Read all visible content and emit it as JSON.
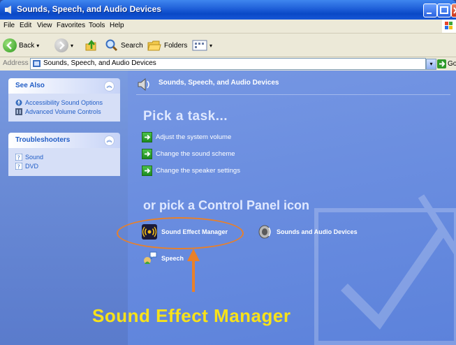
{
  "window": {
    "title": "Sounds, Speech, and Audio Devices",
    "controls": {
      "minimize": "minimize",
      "maximize": "maximize",
      "close": "close"
    }
  },
  "menubar": {
    "items": [
      "File",
      "Edit",
      "View",
      "Favorites",
      "Tools",
      "Help"
    ]
  },
  "toolbar": {
    "back_label": "Back",
    "search_label": "Search",
    "folders_label": "Folders"
  },
  "address": {
    "label": "Address",
    "value": "Sounds, Speech, and Audio Devices",
    "go_label": "Go"
  },
  "sidebar": {
    "see_also": {
      "title": "See Also",
      "items": [
        "Accessibility Sound Options",
        "Advanced Volume Controls"
      ]
    },
    "troubleshooters": {
      "title": "Troubleshooters",
      "items": [
        "Sound",
        "DVD"
      ]
    }
  },
  "main": {
    "category_title": "Sounds, Speech, and Audio Devices",
    "pick_task": "Pick a task...",
    "tasks": [
      "Adjust the system volume",
      "Change the sound scheme",
      "Change the speaker settings"
    ],
    "or_pick": "or pick a Control Panel icon",
    "icons": [
      {
        "label": "Sound Effect Manager",
        "icon": "sound-effect-manager-icon"
      },
      {
        "label": "Sounds and Audio Devices",
        "icon": "speaker-icon"
      },
      {
        "label": "Speech",
        "icon": "speech-icon"
      }
    ]
  },
  "annotation": {
    "text": "Sound Effect Manager",
    "color": "#f7e21a",
    "marker_color": "#e8802a"
  },
  "colors": {
    "xp_blue": "#0a49c6",
    "task_pane": "#6a8bd6",
    "link_blue": "#215dc6"
  }
}
